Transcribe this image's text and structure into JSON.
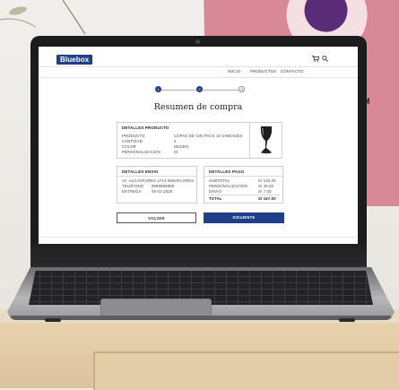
{
  "site": {
    "brand": "Bluebox"
  },
  "nav": {
    "items": [
      "INICIO",
      "PRODUCTOS",
      "CONTACTO"
    ]
  },
  "stepper": {
    "steps": [
      "1",
      "2",
      "3"
    ],
    "current": 3
  },
  "summary": {
    "title": "Resumen de compra"
  },
  "product": {
    "heading": "DETALLES PRODUCTO",
    "rows": [
      {
        "label": "PRODUCTO",
        "value": "COPAS DE GIN PACK 10 UNIDADES"
      },
      {
        "label": "CANTIDAD",
        "value": "2"
      },
      {
        "label": "COLOR",
        "value": "NEGRO"
      },
      {
        "label": "PERSONALIZACIÓN",
        "value": "SÍ"
      }
    ]
  },
  "shipping": {
    "heading": "DETALLES ENVIO",
    "address": "AV. ALCANFORES 2713 MIRAFLORES",
    "phone_label": "TELÉFONO",
    "phone_value": "9999999999",
    "delivery_label": "ENTREGA",
    "delivery_value": "05-01-2020"
  },
  "payment": {
    "heading": "DETALLES PAGO",
    "rows": [
      {
        "label": "SUBTOTAL",
        "value": "S/  120.00"
      },
      {
        "label": "PERSONALIZACIÓN",
        "value": "S/   40.00"
      },
      {
        "label": "ENVIO",
        "value": "S/     7.00"
      }
    ],
    "total_label": "TOTAL",
    "total_value": "S/  167.00"
  },
  "buttons": {
    "back": "VOLVER",
    "next": "SIGUIENTE"
  },
  "colors": {
    "brand": "#1f3f86",
    "poster_pink": "#d98897",
    "poster_purple": "#5a2c78"
  },
  "icons": [
    "cart-icon",
    "search-icon"
  ],
  "scene": {
    "wall_mark": "M"
  }
}
